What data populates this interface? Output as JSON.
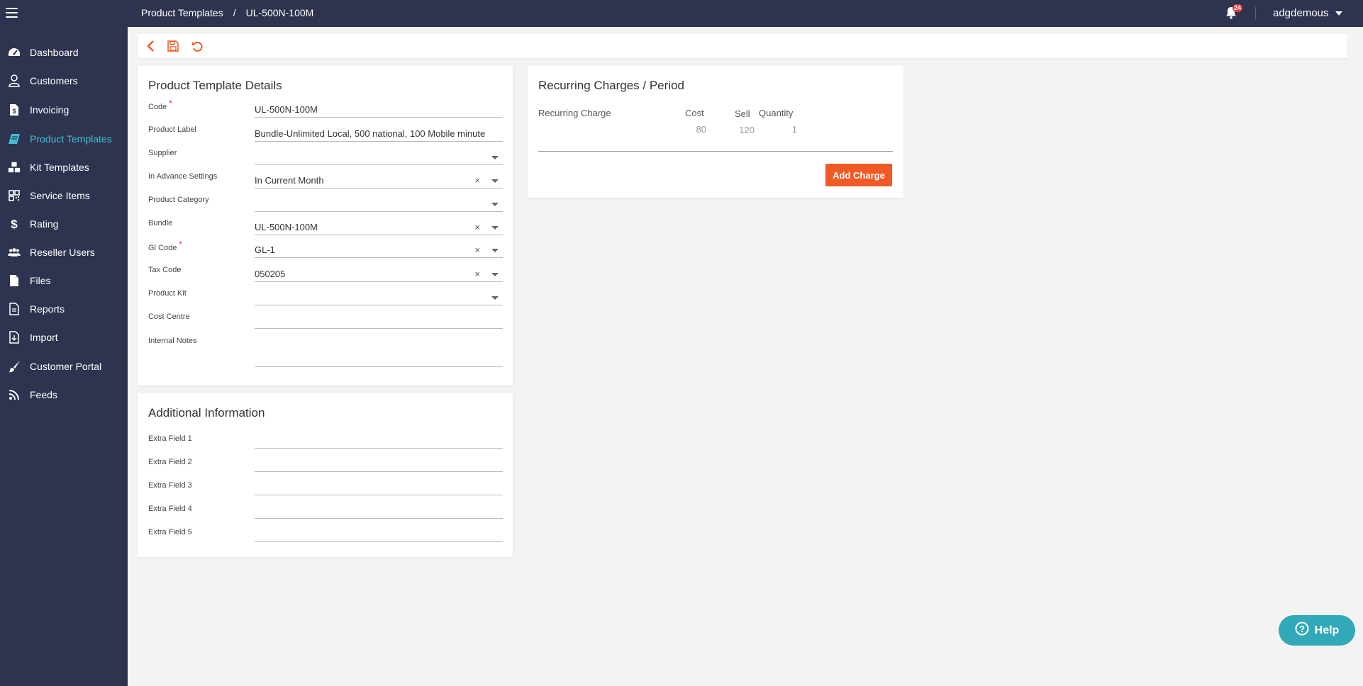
{
  "header": {
    "breadcrumb": [
      "Product Templates",
      "/",
      "UL-500N-100M"
    ],
    "notifications_count": "24",
    "username": "adgdemous"
  },
  "sidebar": {
    "items": [
      {
        "label": "Dashboard",
        "icon": "dashboard-icon"
      },
      {
        "label": "Customers",
        "icon": "user-icon"
      },
      {
        "label": "Invoicing",
        "icon": "invoice-icon"
      },
      {
        "label": "Product Templates",
        "icon": "book-icon",
        "active": true
      },
      {
        "label": "Kit Templates",
        "icon": "cubes-icon"
      },
      {
        "label": "Service Items",
        "icon": "qrcode-icon"
      },
      {
        "label": "Rating",
        "icon": "dollar-icon"
      },
      {
        "label": "Reseller Users",
        "icon": "users-icon"
      },
      {
        "label": "Files",
        "icon": "file-icon"
      },
      {
        "label": "Reports",
        "icon": "report-icon"
      },
      {
        "label": "Import",
        "icon": "import-icon"
      },
      {
        "label": "Customer Portal",
        "icon": "brush-icon"
      },
      {
        "label": "Feeds",
        "icon": "rss-icon"
      }
    ]
  },
  "toolbar": {
    "icons": [
      "back-icon",
      "save-icon",
      "undo-icon"
    ]
  },
  "details": {
    "title": "Product Template Details",
    "fields": [
      {
        "label": "Code",
        "value": "UL-500N-100M",
        "required": true
      },
      {
        "label": "Product Label",
        "value": "Bundle-Unlimited Local, 500 national, 100 Mobile minute"
      },
      {
        "label": "Supplier",
        "value": ""
      },
      {
        "label": "In Advance Settings",
        "value": "In Current Month"
      },
      {
        "label": "Product Category",
        "value": ""
      },
      {
        "label": "Bundle",
        "value": "UL-500N-100M"
      },
      {
        "label": "Gl Code",
        "value": "GL-1",
        "required": true
      },
      {
        "label": "Tax Code",
        "value": "050205"
      },
      {
        "label": "Product Kit",
        "value": ""
      },
      {
        "label": "Cost Centre",
        "value": ""
      },
      {
        "label": "Internal Notes",
        "value": ""
      }
    ]
  },
  "additional": {
    "title": "Additional Information",
    "fields": [
      {
        "label": "Extra Field 1",
        "value": ""
      },
      {
        "label": "Extra Field 2",
        "value": ""
      },
      {
        "label": "Extra Field 3",
        "value": ""
      },
      {
        "label": "Extra Field 4",
        "value": ""
      },
      {
        "label": "Extra Field 5",
        "value": ""
      }
    ]
  },
  "recurring": {
    "title": "Recurring Charges / Period",
    "columns": {
      "charge": "Recurring Charge",
      "cost": "Cost",
      "sell": "Sell",
      "quantity": "Quantity"
    },
    "rows": [
      {
        "charge": "",
        "cost": "80",
        "sell": "120",
        "quantity": "1"
      }
    ],
    "add_label": "Add Charge"
  },
  "help": {
    "label": "Help"
  },
  "colors": {
    "sidebar_bg": "#2e3350",
    "accent_active": "#3ec1d3",
    "action_orange": "#f25a25",
    "help_teal": "#31a9b8"
  }
}
